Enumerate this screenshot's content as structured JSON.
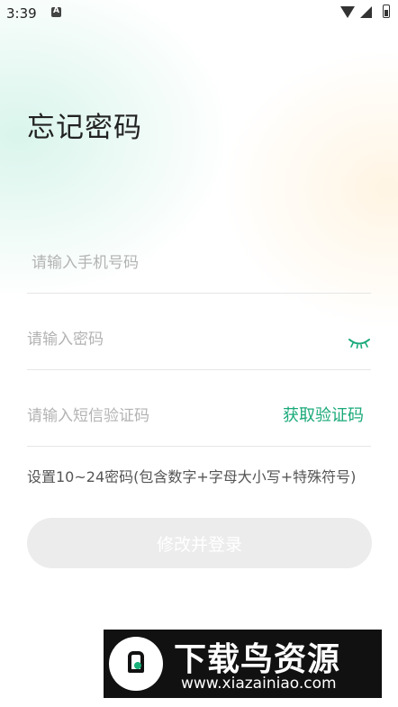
{
  "status_bar": {
    "time": "3:39",
    "icons": [
      "a-notification-icon",
      "wifi-icon",
      "signal-icon",
      "battery-icon"
    ]
  },
  "page": {
    "title": "忘记密码"
  },
  "form": {
    "phone_placeholder": "请输入手机号码",
    "phone_value": "",
    "password_placeholder": "请输入密码",
    "password_value": "",
    "password_toggle_icon": "eye-closed-icon",
    "sms_placeholder": "请输入短信验证码",
    "sms_value": "",
    "get_code_label": "获取验证码",
    "password_hint": "设置10~24密码(包含数字+字母大小写+特殊符号)",
    "submit_label": "修改并登录"
  },
  "watermark": {
    "title": "下载鸟资源",
    "url": "www.xiazainiao.com"
  },
  "colors": {
    "accent": "#1aa97a",
    "button_disabled_bg": "#ececec",
    "placeholder": "#b3b3b3"
  }
}
